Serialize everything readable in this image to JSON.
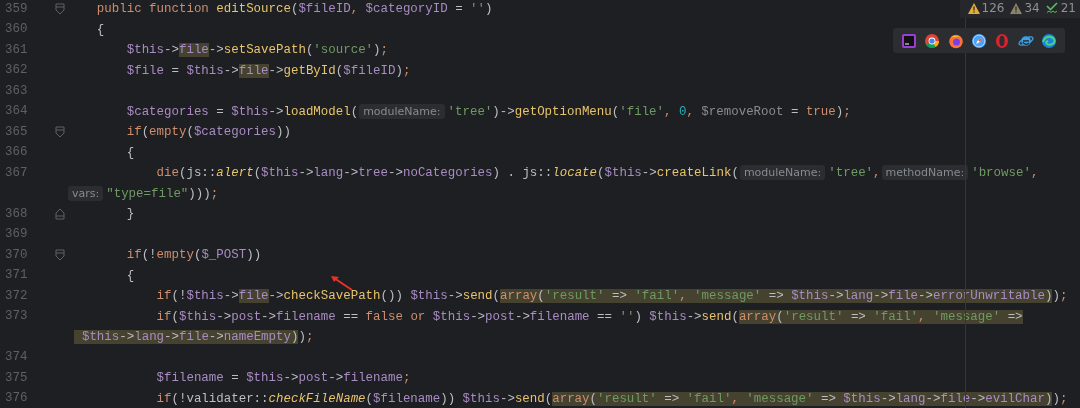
{
  "inspections": [
    {
      "kind": "warning",
      "count": "126"
    },
    {
      "kind": "weak_warning",
      "count": "34"
    },
    {
      "kind": "typo",
      "count": "21"
    }
  ],
  "lines": [
    {
      "num": "359",
      "fold": {
        "kind": "start"
      },
      "tokens": [
        {
          "t": "    public function ",
          "kind": "kw"
        },
        {
          "t": "editSource",
          "kind": "fn"
        },
        {
          "t": "(",
          "kind": "p"
        },
        {
          "t": "$fileID",
          "kind": "v"
        },
        {
          "t": ",",
          "kind": "kw"
        },
        {
          "t": " $categoryID",
          "kind": "v"
        },
        {
          "t": " = ",
          "kind": "p"
        },
        {
          "t": "''",
          "kind": "str"
        },
        {
          "t": ")",
          "kind": "p"
        }
      ]
    },
    {
      "num": "360",
      "tokens": [
        {
          "t": "    {",
          "kind": "p"
        }
      ]
    },
    {
      "num": "361",
      "tokens": [
        {
          "t": "        $this",
          "kind": "v"
        },
        {
          "t": "->",
          "kind": "p"
        },
        {
          "t": "file",
          "kind": "v",
          "hl": true
        },
        {
          "t": "->",
          "kind": "p"
        },
        {
          "t": "setSavePath",
          "kind": "fn"
        },
        {
          "t": "(",
          "kind": "p"
        },
        {
          "t": "'source'",
          "kind": "str"
        },
        {
          "t": ")",
          "kind": "p"
        },
        {
          "t": ";",
          "kind": "kw"
        }
      ]
    },
    {
      "num": "362",
      "tokens": [
        {
          "t": "        $file",
          "kind": "v"
        },
        {
          "t": " = ",
          "kind": "p"
        },
        {
          "t": "$this",
          "kind": "v"
        },
        {
          "t": "->",
          "kind": "p"
        },
        {
          "t": "file",
          "kind": "v",
          "hl": true
        },
        {
          "t": "->",
          "kind": "p"
        },
        {
          "t": "getById",
          "kind": "fn"
        },
        {
          "t": "(",
          "kind": "p"
        },
        {
          "t": "$fileID",
          "kind": "v"
        },
        {
          "t": ")",
          "kind": "p"
        },
        {
          "t": ";",
          "kind": "kw"
        }
      ]
    },
    {
      "num": "363"
    },
    {
      "num": "364",
      "tokens": [
        {
          "t": "        $categories",
          "kind": "v"
        },
        {
          "t": " = ",
          "kind": "p"
        },
        {
          "t": "$this",
          "kind": "v"
        },
        {
          "t": "->",
          "kind": "p"
        },
        {
          "t": "loadModel",
          "kind": "fn"
        },
        {
          "t": "(",
          "kind": "p"
        },
        {
          "t": "moduleName:",
          "kind": "hint"
        },
        {
          "t": "'tree'",
          "kind": "str"
        },
        {
          "t": ")->",
          "kind": "p"
        },
        {
          "t": "getOptionMenu",
          "kind": "fn"
        },
        {
          "t": "(",
          "kind": "p"
        },
        {
          "t": "'file'",
          "kind": "str"
        },
        {
          "t": ",",
          "kind": "kw"
        },
        {
          "t": " 0",
          "kind": "num"
        },
        {
          "t": ",",
          "kind": "kw"
        },
        {
          "t": " $removeRoot",
          "kind": "dim"
        },
        {
          "t": " = ",
          "kind": "p"
        },
        {
          "t": "true",
          "kind": "kw"
        },
        {
          "t": ")",
          "kind": "p"
        },
        {
          "t": ";",
          "kind": "kw"
        }
      ]
    },
    {
      "num": "365",
      "fold": {
        "kind": "start"
      },
      "tokens": [
        {
          "t": "        if",
          "kind": "kw"
        },
        {
          "t": "(",
          "kind": "p"
        },
        {
          "t": "empty",
          "kind": "kw"
        },
        {
          "t": "(",
          "kind": "p"
        },
        {
          "t": "$categories",
          "kind": "v"
        },
        {
          "t": "))",
          "kind": "p"
        }
      ]
    },
    {
      "num": "366",
      "tokens": [
        {
          "t": "        {",
          "kind": "p"
        }
      ]
    },
    {
      "num": "367",
      "tokens": [
        {
          "t": "            die",
          "kind": "kw"
        },
        {
          "t": "(js::",
          "kind": "p"
        },
        {
          "t": "alert",
          "kind": "fi"
        },
        {
          "t": "(",
          "kind": "p"
        },
        {
          "t": "$this",
          "kind": "v"
        },
        {
          "t": "->",
          "kind": "p"
        },
        {
          "t": "lang",
          "kind": "v"
        },
        {
          "t": "->",
          "kind": "p"
        },
        {
          "t": "tree",
          "kind": "v"
        },
        {
          "t": "->",
          "kind": "p"
        },
        {
          "t": "noCategories",
          "kind": "v"
        },
        {
          "t": ") . js::",
          "kind": "p"
        },
        {
          "t": "locate",
          "kind": "fi"
        },
        {
          "t": "(",
          "kind": "p"
        },
        {
          "t": "$this",
          "kind": "v"
        },
        {
          "t": "->",
          "kind": "p"
        },
        {
          "t": "createLink",
          "kind": "fn"
        },
        {
          "t": "(",
          "kind": "p"
        },
        {
          "t": "moduleName:",
          "kind": "hint"
        },
        {
          "t": "'tree'",
          "kind": "str"
        },
        {
          "t": ",",
          "kind": "kw"
        },
        {
          "t": "methodName:",
          "kind": "hint"
        },
        {
          "t": "'browse'",
          "kind": "str"
        },
        {
          "t": ",",
          "kind": "kw"
        }
      ]
    },
    {
      "tokens": [
        {
          "t": "vars:",
          "kind": "hint"
        },
        {
          "t": "\"type=file\"",
          "kind": "str"
        },
        {
          "t": ")))",
          "kind": "p"
        },
        {
          "t": ";",
          "kind": "kw"
        }
      ]
    },
    {
      "num": "368",
      "fold": {
        "kind": "end"
      },
      "tokens": [
        {
          "t": "        }",
          "kind": "p"
        }
      ]
    },
    {
      "num": "369"
    },
    {
      "num": "370",
      "fold": {
        "kind": "start"
      },
      "tokens": [
        {
          "t": "        if",
          "kind": "kw"
        },
        {
          "t": "(!",
          "kind": "p"
        },
        {
          "t": "empty",
          "kind": "kw"
        },
        {
          "t": "(",
          "kind": "p"
        },
        {
          "t": "$_POST",
          "kind": "v"
        },
        {
          "t": "))",
          "kind": "p"
        }
      ]
    },
    {
      "num": "371",
      "tokens": [
        {
          "t": "        {",
          "kind": "p"
        }
      ]
    },
    {
      "num": "372",
      "tokens": [
        {
          "t": "            if",
          "kind": "kw"
        },
        {
          "t": "(!",
          "kind": "p"
        },
        {
          "t": "$this",
          "kind": "v"
        },
        {
          "t": "->",
          "kind": "p"
        },
        {
          "t": "file",
          "kind": "v",
          "hl": true
        },
        {
          "t": "->",
          "kind": "p"
        },
        {
          "t": "checkSavePath",
          "kind": "fn"
        },
        {
          "t": "())",
          "kind": "p"
        },
        {
          "t": " $this",
          "kind": "v"
        },
        {
          "t": "->",
          "kind": "p"
        },
        {
          "t": "send",
          "kind": "fn"
        },
        {
          "t": "(",
          "kind": "p"
        },
        {
          "t": "array",
          "kind": "kw",
          "hl": true
        },
        {
          "t": "(",
          "kind": "p",
          "hl": true
        },
        {
          "t": "'result'",
          "kind": "str",
          "hl": true
        },
        {
          "t": " => ",
          "kind": "p",
          "hl": true
        },
        {
          "t": "'fail'",
          "kind": "str",
          "hl": true
        },
        {
          "t": ",",
          "kind": "kw",
          "hl": true
        },
        {
          "t": " 'message'",
          "kind": "str",
          "hl": true
        },
        {
          "t": " => ",
          "kind": "p",
          "hl": true
        },
        {
          "t": "$this",
          "kind": "v",
          "hl": true
        },
        {
          "t": "->",
          "kind": "p",
          "hl": true
        },
        {
          "t": "lang",
          "kind": "v",
          "hl": true
        },
        {
          "t": "->",
          "kind": "p",
          "hl": true
        },
        {
          "t": "file",
          "kind": "v",
          "hl": true
        },
        {
          "t": "->",
          "kind": "p",
          "hl": true
        },
        {
          "t": "errorUnwritable",
          "kind": "v",
          "hl": true
        },
        {
          "t": ")",
          "kind": "p",
          "hl": true
        },
        {
          "t": ")",
          "kind": "p"
        },
        {
          "t": ";",
          "kind": "kw"
        }
      ]
    },
    {
      "num": "373",
      "tokens": [
        {
          "t": "            if",
          "kind": "kw"
        },
        {
          "t": "(",
          "kind": "p"
        },
        {
          "t": "$this",
          "kind": "v"
        },
        {
          "t": "->",
          "kind": "p"
        },
        {
          "t": "post",
          "kind": "v"
        },
        {
          "t": "->",
          "kind": "p"
        },
        {
          "t": "filename",
          "kind": "v"
        },
        {
          "t": " == ",
          "kind": "p"
        },
        {
          "t": "false or",
          "kind": "kw"
        },
        {
          "t": " $this",
          "kind": "v"
        },
        {
          "t": "->",
          "kind": "p"
        },
        {
          "t": "post",
          "kind": "v"
        },
        {
          "t": "->",
          "kind": "p"
        },
        {
          "t": "filename",
          "kind": "v"
        },
        {
          "t": " == ",
          "kind": "p"
        },
        {
          "t": "''",
          "kind": "str"
        },
        {
          "t": ")",
          "kind": "p"
        },
        {
          "t": " $this",
          "kind": "v"
        },
        {
          "t": "->",
          "kind": "p"
        },
        {
          "t": "send",
          "kind": "fn"
        },
        {
          "t": "(",
          "kind": "p"
        },
        {
          "t": "array",
          "kind": "kw",
          "hl": true
        },
        {
          "t": "(",
          "kind": "p",
          "hl": true
        },
        {
          "t": "'result'",
          "kind": "str",
          "hl": true
        },
        {
          "t": " => ",
          "kind": "p",
          "hl": true
        },
        {
          "t": "'fail'",
          "kind": "str",
          "hl": true
        },
        {
          "t": ",",
          "kind": "kw",
          "hl": true
        },
        {
          "t": " 'message'",
          "kind": "str",
          "hl": true
        },
        {
          "t": " =>",
          "kind": "p",
          "hl": true
        }
      ]
    },
    {
      "tokens": [
        {
          "t": " $this",
          "kind": "v",
          "hl": true
        },
        {
          "t": "->",
          "kind": "p",
          "hl": true
        },
        {
          "t": "lang",
          "kind": "v",
          "hl": true
        },
        {
          "t": "->",
          "kind": "p",
          "hl": true
        },
        {
          "t": "file",
          "kind": "v",
          "hl": true
        },
        {
          "t": "->",
          "kind": "p",
          "hl": true
        },
        {
          "t": "nameEmpty",
          "kind": "v",
          "hl": true
        },
        {
          "t": ")",
          "kind": "p",
          "hl": true
        },
        {
          "t": ")",
          "kind": "p"
        },
        {
          "t": ";",
          "kind": "kw"
        }
      ]
    },
    {
      "num": "374"
    },
    {
      "num": "375",
      "tokens": [
        {
          "t": "            $filename",
          "kind": "v"
        },
        {
          "t": " = ",
          "kind": "p"
        },
        {
          "t": "$this",
          "kind": "v"
        },
        {
          "t": "->",
          "kind": "p"
        },
        {
          "t": "post",
          "kind": "v"
        },
        {
          "t": "->",
          "kind": "p"
        },
        {
          "t": "filename",
          "kind": "v"
        },
        {
          "t": ";",
          "kind": "kw"
        }
      ]
    },
    {
      "num": "376",
      "tokens": [
        {
          "t": "            if",
          "kind": "kw"
        },
        {
          "t": "(!validater::",
          "kind": "p"
        },
        {
          "t": "checkFileName",
          "kind": "fi"
        },
        {
          "t": "(",
          "kind": "p"
        },
        {
          "t": "$filename",
          "kind": "v"
        },
        {
          "t": "))",
          "kind": "p"
        },
        {
          "t": " $this",
          "kind": "v"
        },
        {
          "t": "->",
          "kind": "p"
        },
        {
          "t": "send",
          "kind": "fn"
        },
        {
          "t": "(",
          "kind": "p"
        },
        {
          "t": "array",
          "kind": "kw",
          "hl": true
        },
        {
          "t": "(",
          "kind": "p",
          "hl": true
        },
        {
          "t": "'result'",
          "kind": "str",
          "hl": true
        },
        {
          "t": " => ",
          "kind": "p",
          "hl": true
        },
        {
          "t": "'fail'",
          "kind": "str",
          "hl": true
        },
        {
          "t": ",",
          "kind": "kw",
          "hl": true
        },
        {
          "t": " 'message'",
          "kind": "str",
          "hl": true
        },
        {
          "t": " => ",
          "kind": "p",
          "hl": true
        },
        {
          "t": "$this",
          "kind": "v",
          "hl": true
        },
        {
          "t": "->",
          "kind": "p",
          "hl": true
        },
        {
          "t": "lang",
          "kind": "v",
          "hl": true
        },
        {
          "t": "->",
          "kind": "p",
          "hl": true
        },
        {
          "t": "file",
          "kind": "v",
          "hl": true
        },
        {
          "t": "->",
          "kind": "p",
          "hl": true
        },
        {
          "t": "evilChar",
          "kind": "v",
          "hl": true
        },
        {
          "t": ")",
          "kind": "p",
          "hl": true
        },
        {
          "t": ")",
          "kind": "p"
        },
        {
          "t": ";",
          "kind": "kw"
        }
      ]
    }
  ]
}
